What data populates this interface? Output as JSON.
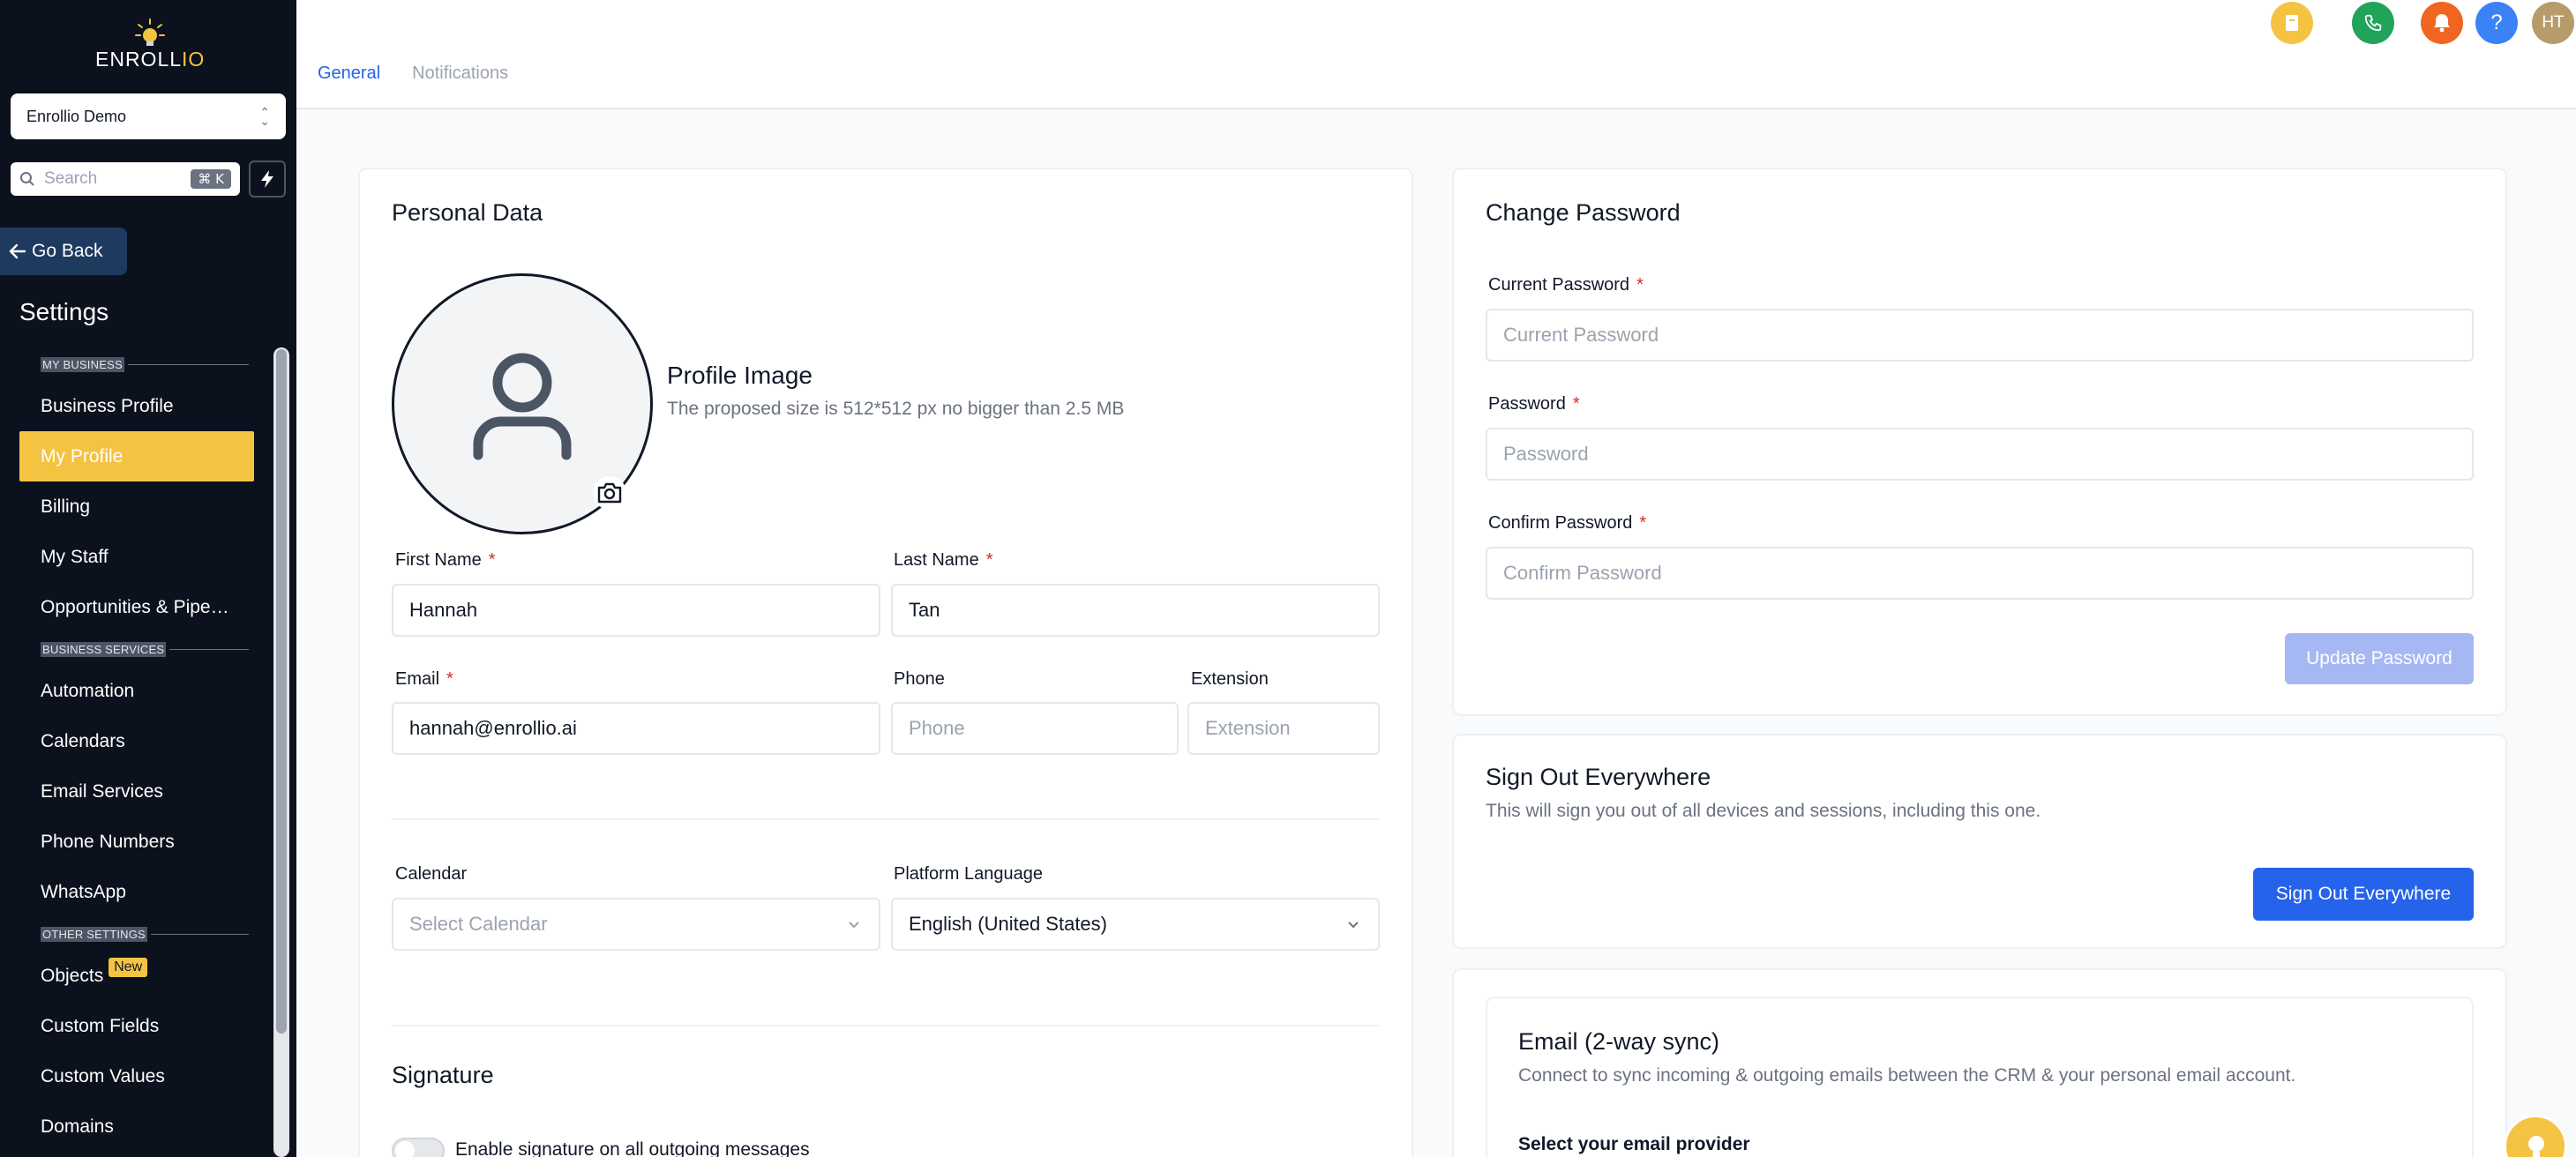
{
  "app": {
    "logo_text_a": "ENROLL",
    "logo_text_b": "IO",
    "account": "Enrollio Demo",
    "search_placeholder": "Search",
    "search_shortcut": "⌘ K",
    "go_back": "Go Back",
    "settings_title": "Settings"
  },
  "sidebar": {
    "sections": [
      {
        "title": "MY BUSINESS",
        "items": [
          {
            "label": "Business Profile",
            "active": false
          },
          {
            "label": "My Profile",
            "active": true
          },
          {
            "label": "Billing",
            "active": false
          },
          {
            "label": "My Staff",
            "active": false
          },
          {
            "label": "Opportunities & Pipe…",
            "active": false
          }
        ]
      },
      {
        "title": "BUSINESS SERVICES",
        "items": [
          {
            "label": "Automation",
            "active": false
          },
          {
            "label": "Calendars",
            "active": false
          },
          {
            "label": "Email Services",
            "active": false
          },
          {
            "label": "Phone Numbers",
            "active": false
          },
          {
            "label": "WhatsApp",
            "active": false
          }
        ]
      },
      {
        "title": "OTHER SETTINGS",
        "items": [
          {
            "label": "Objects",
            "badge": "New",
            "active": false
          },
          {
            "label": "Custom Fields",
            "active": false
          },
          {
            "label": "Custom Values",
            "active": false
          },
          {
            "label": "Domains",
            "active": false
          }
        ]
      }
    ]
  },
  "header": {
    "tabs": [
      {
        "label": "General",
        "active": true
      },
      {
        "label": "Notifications",
        "active": false
      }
    ],
    "user_initials": "HT",
    "icon_colors": {
      "book": "#f5c342",
      "phone": "#22a35a",
      "bell": "#f0651f",
      "help": "#3b82f6",
      "avatar": "#b79b6a"
    }
  },
  "personal": {
    "title": "Personal Data",
    "profile_image_title": "Profile Image",
    "profile_image_hint": "The proposed size is 512*512 px no bigger than 2.5 MB",
    "first_name_label": "First Name",
    "first_name_value": "Hannah",
    "last_name_label": "Last Name",
    "last_name_value": "Tan",
    "email_label": "Email",
    "email_value": "hannah@enrollio.ai",
    "phone_label": "Phone",
    "phone_placeholder": "Phone",
    "extension_label": "Extension",
    "extension_placeholder": "Extension",
    "calendar_label": "Calendar",
    "calendar_placeholder": "Select Calendar",
    "language_label": "Platform Language",
    "language_value": "English (United States)",
    "required_mark": "*",
    "signature_title": "Signature",
    "signature_toggle_label": "Enable signature on all outgoing messages"
  },
  "password": {
    "title": "Change Password",
    "current_label": "Current Password",
    "current_placeholder": "Current Password",
    "new_label": "Password",
    "new_placeholder": "Password",
    "confirm_label": "Confirm Password",
    "confirm_placeholder": "Confirm Password",
    "update_button": "Update Password"
  },
  "signout": {
    "title": "Sign Out Everywhere",
    "description": "This will sign you out of all devices and sessions, including this one.",
    "button": "Sign Out Everywhere"
  },
  "email_sync": {
    "title": "Email (2-way sync)",
    "description": "Connect to sync incoming & outgoing emails between the CRM & your personal email account.",
    "provider_label": "Select your email provider"
  }
}
